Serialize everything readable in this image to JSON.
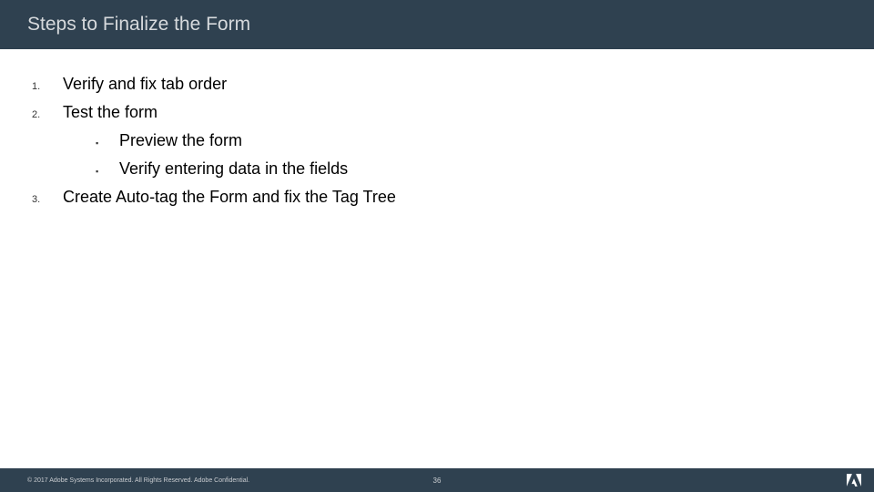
{
  "header": {
    "title": "Steps to Finalize the Form"
  },
  "steps": [
    {
      "num": "1.",
      "text": "Verify and fix tab order"
    },
    {
      "num": "2.",
      "text": "Test the form"
    },
    {
      "num": "3.",
      "text": "Create Auto-tag the Form and fix the Tag Tree"
    }
  ],
  "substeps": [
    {
      "bullet": "▪",
      "text": "Preview the form"
    },
    {
      "bullet": "▪",
      "text": "Verify entering data in the fields"
    }
  ],
  "footer": {
    "copyright": "© 2017 Adobe Systems Incorporated.  All Rights Reserved.  Adobe Confidential.",
    "page": "36"
  }
}
